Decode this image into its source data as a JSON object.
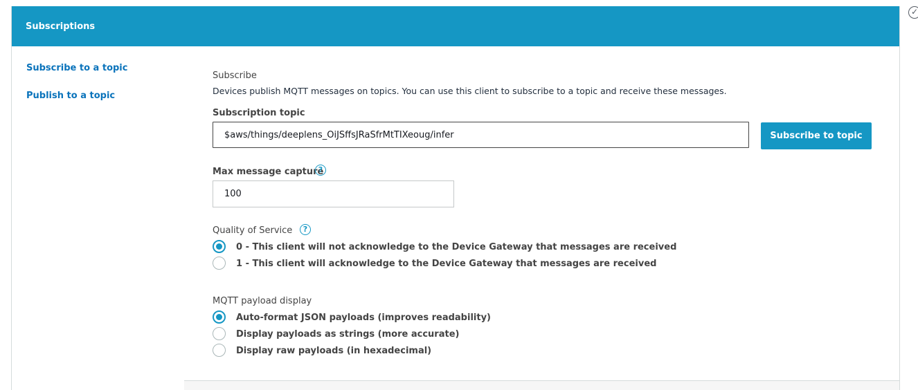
{
  "sidebar": {
    "header": "Subscriptions",
    "links": [
      "Subscribe to a topic",
      "Publish to a topic"
    ]
  },
  "subscribe": {
    "section_title": "Subscribe",
    "description": "Devices publish MQTT messages on topics. You can use this client to subscribe to a topic and receive these messages.",
    "topic_label": "Subscription topic",
    "topic_value": "$aws/things/deeplens_OiJSffsJRaSfrMtTIXeoug/infer",
    "button_label": "Subscribe to topic",
    "capture_label": "Max message capture",
    "capture_value": "100",
    "help_glyph": "?",
    "qos_label": "Quality of Service",
    "qos_options": [
      {
        "label": "0 - This client will not acknowledge to the Device Gateway that messages are received",
        "checked": true
      },
      {
        "label": "1 - This client will acknowledge to the Device Gateway that messages are received",
        "checked": false
      }
    ],
    "payload_label": "MQTT payload display",
    "payload_options": [
      {
        "label": "Auto-format JSON payloads (improves readability)",
        "checked": true
      },
      {
        "label": "Display payloads as strings (more accurate)",
        "checked": false
      },
      {
        "label": "Display raw payloads (in hexadecimal)",
        "checked": false
      }
    ]
  },
  "colors": {
    "accent": "#1597c4",
    "link": "#0a73bb"
  },
  "icons": {
    "corner": "check-circle-icon",
    "help": "help-circle-icon"
  }
}
